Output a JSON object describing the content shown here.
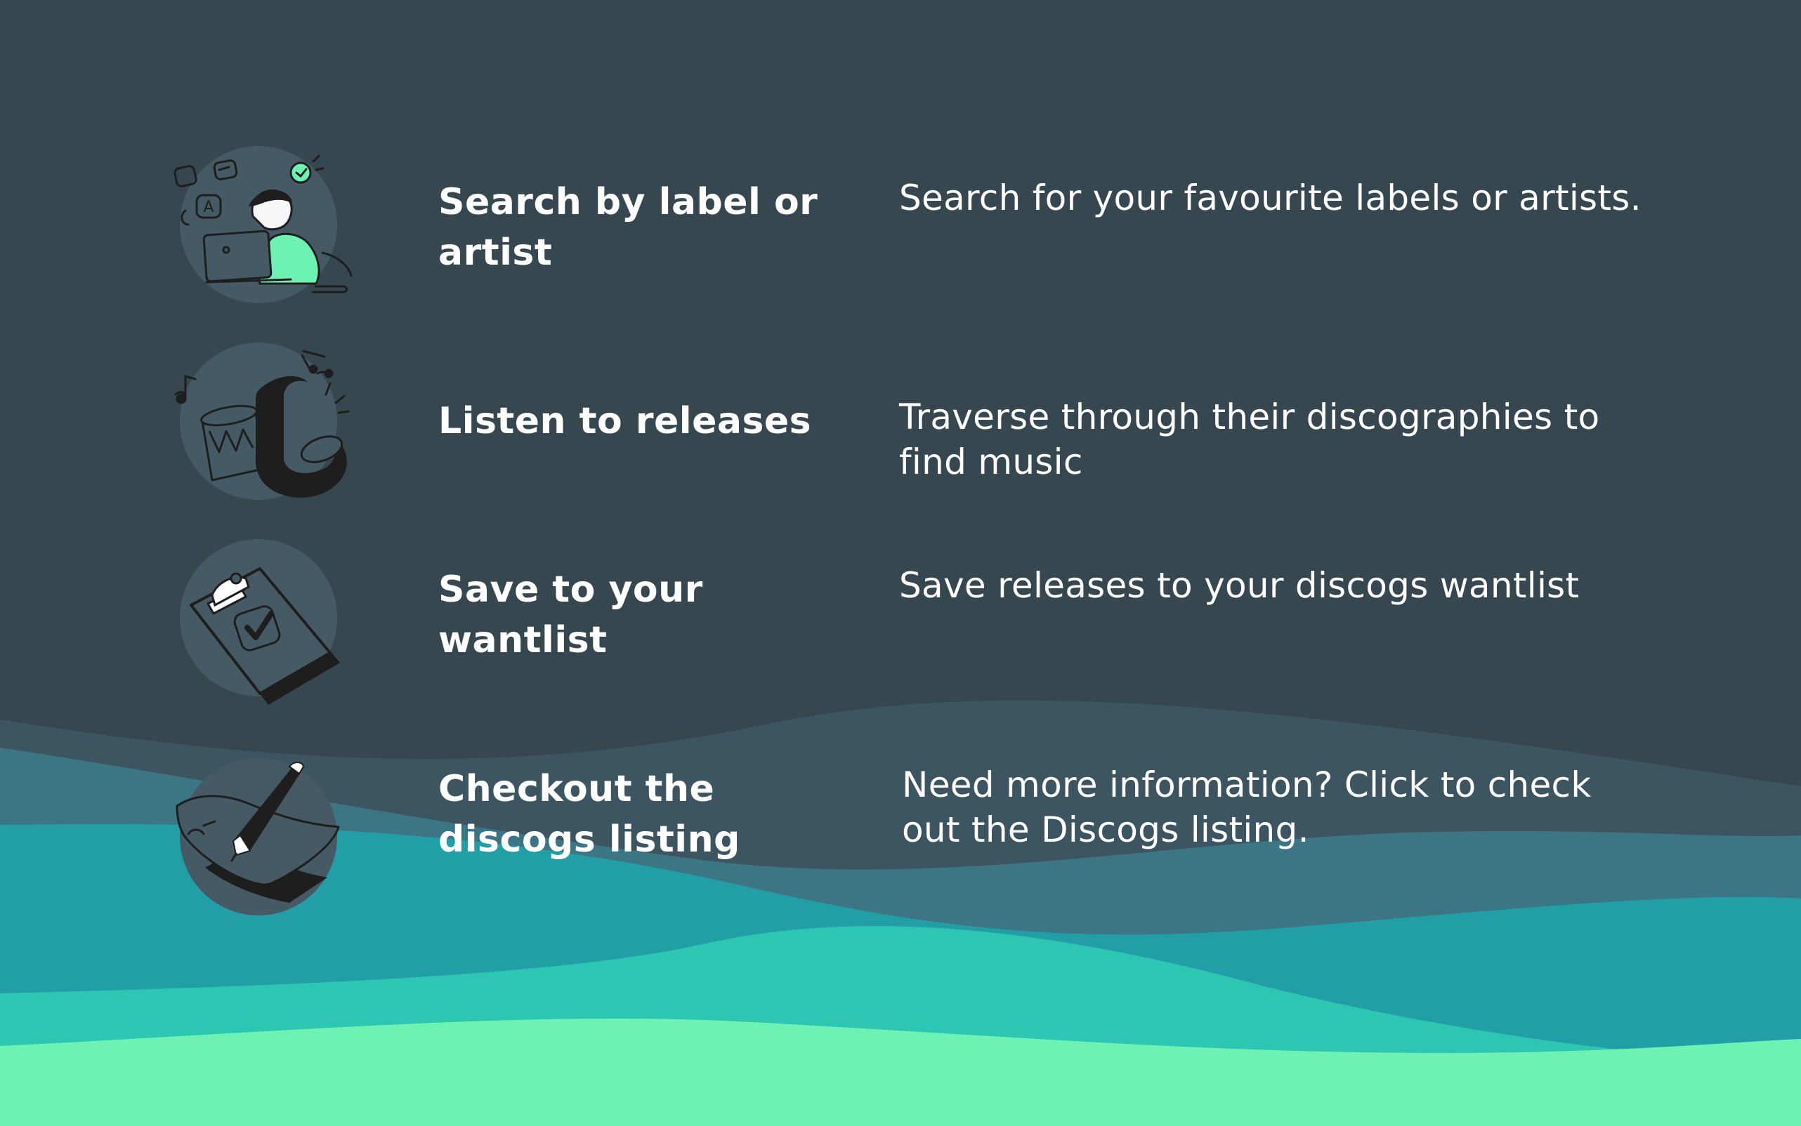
{
  "features": [
    {
      "title": "Search by label or artist",
      "description": "Search for your favourite labels or artists.",
      "icon": "person-laptop-icon"
    },
    {
      "title": "Listen to releases",
      "description": "Traverse through their discographies to find music",
      "icon": "music-instruments-icon"
    },
    {
      "title": "Save to your wantlist",
      "description": "Save releases to your discogs wantlist",
      "icon": "clipboard-check-icon"
    },
    {
      "title": "Checkout the discogs listing",
      "description": "Need more information? Click to check out the Discogs listing.",
      "icon": "pen-paper-icon"
    }
  ],
  "colors": {
    "background": "#37474f",
    "icon_circle": "#455a64",
    "accent_green": "#6ef2b4",
    "wave_teal": "#2cc6b2",
    "wave_mid": "#229ea6",
    "wave_slate": "#3c7584",
    "text": "#ffffff"
  }
}
